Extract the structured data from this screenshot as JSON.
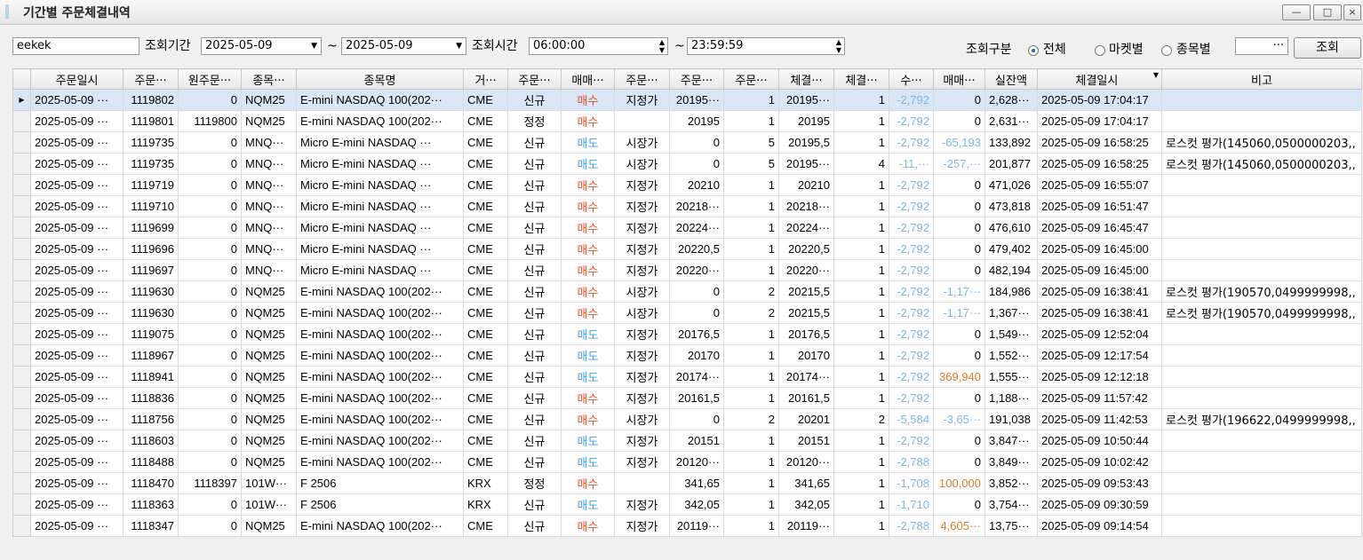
{
  "window": {
    "title": "기간별 주문체결내역",
    "min_label": "—",
    "max_label": "□",
    "close_label": "×"
  },
  "toolbar": {
    "account": "eekek",
    "period_label": "조회기간",
    "date_from": "2025-05-09",
    "tilde": "~",
    "date_to": "2025-05-09",
    "time_label": "조회시간",
    "time_from": "06:00:00",
    "time_to": "23:59:59",
    "category_label": "조회구분",
    "opt_all": "전체",
    "opt_market": "마켓별",
    "opt_symbol": "종목별",
    "symbol_btn": "···",
    "search_btn": "조회"
  },
  "columns": [
    "주문일시",
    "주문···",
    "원주문···",
    "종목···",
    "종목명",
    "거···",
    "주문···",
    "매매···",
    "주문···",
    "주문···",
    "주문···",
    "체결···",
    "체결···",
    "수···",
    "매매···",
    "실잔액",
    "체결일시",
    "비고"
  ],
  "rows": [
    [
      "2025-05-09 ···",
      "1119802",
      "0",
      "NQM25",
      "E-mini NASDAQ 100(202···",
      "CME",
      "신규",
      "매수",
      "지정가",
      "20195···",
      "1",
      "20195···",
      "1",
      "-2,792",
      "0",
      "2,628···",
      "2025-05-09 17:04:17",
      ""
    ],
    [
      "2025-05-09 ···",
      "1119801",
      "1119800",
      "NQM25",
      "E-mini NASDAQ 100(202···",
      "CME",
      "정정",
      "매수",
      "",
      "20195",
      "1",
      "20195",
      "1",
      "-2,792",
      "0",
      "2,631···",
      "2025-05-09 17:04:17",
      ""
    ],
    [
      "2025-05-09 ···",
      "1119735",
      "0",
      "MNQ···",
      "Micro E-mini NASDAQ ···",
      "CME",
      "신규",
      "매도",
      "시장가",
      "0",
      "5",
      "20195,5",
      "1",
      "-2,792",
      "-65,193",
      "133,892",
      "2025-05-09 16:58:25",
      "로스컷 평가(145060,0500000203,,"
    ],
    [
      "2025-05-09 ···",
      "1119735",
      "0",
      "MNQ···",
      "Micro E-mini NASDAQ ···",
      "CME",
      "신규",
      "매도",
      "시장가",
      "0",
      "5",
      "20195···",
      "4",
      "-11,···",
      "-257,···",
      "201,877",
      "2025-05-09 16:58:25",
      "로스컷 평가(145060,0500000203,,"
    ],
    [
      "2025-05-09 ···",
      "1119719",
      "0",
      "MNQ···",
      "Micro E-mini NASDAQ ···",
      "CME",
      "신규",
      "매수",
      "지정가",
      "20210",
      "1",
      "20210",
      "1",
      "-2,792",
      "0",
      "471,026",
      "2025-05-09 16:55:07",
      ""
    ],
    [
      "2025-05-09 ···",
      "1119710",
      "0",
      "MNQ···",
      "Micro E-mini NASDAQ ···",
      "CME",
      "신규",
      "매수",
      "지정가",
      "20218···",
      "1",
      "20218···",
      "1",
      "-2,792",
      "0",
      "473,818",
      "2025-05-09 16:51:47",
      ""
    ],
    [
      "2025-05-09 ···",
      "1119699",
      "0",
      "MNQ···",
      "Micro E-mini NASDAQ ···",
      "CME",
      "신규",
      "매수",
      "지정가",
      "20224···",
      "1",
      "20224···",
      "1",
      "-2,792",
      "0",
      "476,610",
      "2025-05-09 16:45:47",
      ""
    ],
    [
      "2025-05-09 ···",
      "1119696",
      "0",
      "MNQ···",
      "Micro E-mini NASDAQ ···",
      "CME",
      "신규",
      "매수",
      "지정가",
      "20220,5",
      "1",
      "20220,5",
      "1",
      "-2,792",
      "0",
      "479,402",
      "2025-05-09 16:45:00",
      ""
    ],
    [
      "2025-05-09 ···",
      "1119697",
      "0",
      "MNQ···",
      "Micro E-mini NASDAQ ···",
      "CME",
      "신규",
      "매수",
      "지정가",
      "20220···",
      "1",
      "20220···",
      "1",
      "-2,792",
      "0",
      "482,194",
      "2025-05-09 16:45:00",
      ""
    ],
    [
      "2025-05-09 ···",
      "1119630",
      "0",
      "NQM25",
      "E-mini NASDAQ 100(202···",
      "CME",
      "신규",
      "매수",
      "시장가",
      "0",
      "2",
      "20215,5",
      "1",
      "-2,792",
      "-1,17···",
      "184,986",
      "2025-05-09 16:38:41",
      "로스컷 평가(190570,0499999998,,"
    ],
    [
      "2025-05-09 ···",
      "1119630",
      "0",
      "NQM25",
      "E-mini NASDAQ 100(202···",
      "CME",
      "신규",
      "매수",
      "시장가",
      "0",
      "2",
      "20215,5",
      "1",
      "-2,792",
      "-1,17···",
      "1,367···",
      "2025-05-09 16:38:41",
      "로스컷 평가(190570,0499999998,,"
    ],
    [
      "2025-05-09 ···",
      "1119075",
      "0",
      "NQM25",
      "E-mini NASDAQ 100(202···",
      "CME",
      "신규",
      "매도",
      "지정가",
      "20176,5",
      "1",
      "20176,5",
      "1",
      "-2,792",
      "0",
      "1,549···",
      "2025-05-09 12:52:04",
      ""
    ],
    [
      "2025-05-09 ···",
      "1118967",
      "0",
      "NQM25",
      "E-mini NASDAQ 100(202···",
      "CME",
      "신규",
      "매도",
      "지정가",
      "20170",
      "1",
      "20170",
      "1",
      "-2,792",
      "0",
      "1,552···",
      "2025-05-09 12:17:54",
      ""
    ],
    [
      "2025-05-09 ···",
      "1118941",
      "0",
      "NQM25",
      "E-mini NASDAQ 100(202···",
      "CME",
      "신규",
      "매도",
      "지정가",
      "20174···",
      "1",
      "20174···",
      "1",
      "-2,792",
      "369,940",
      "1,555···",
      "2025-05-09 12:12:18",
      ""
    ],
    [
      "2025-05-09 ···",
      "1118836",
      "0",
      "NQM25",
      "E-mini NASDAQ 100(202···",
      "CME",
      "신규",
      "매수",
      "지정가",
      "20161,5",
      "1",
      "20161,5",
      "1",
      "-2,792",
      "0",
      "1,188···",
      "2025-05-09 11:57:42",
      ""
    ],
    [
      "2025-05-09 ···",
      "1118756",
      "0",
      "NQM25",
      "E-mini NASDAQ 100(202···",
      "CME",
      "신규",
      "매수",
      "시장가",
      "0",
      "2",
      "20201",
      "2",
      "-5,584",
      "-3,65···",
      "191,038",
      "2025-05-09 11:42:53",
      "로스컷 평가(196622,0499999998,,"
    ],
    [
      "2025-05-09 ···",
      "1118603",
      "0",
      "NQM25",
      "E-mini NASDAQ 100(202···",
      "CME",
      "신규",
      "매도",
      "지정가",
      "20151",
      "1",
      "20151",
      "1",
      "-2,792",
      "0",
      "3,847···",
      "2025-05-09 10:50:44",
      ""
    ],
    [
      "2025-05-09 ···",
      "1118488",
      "0",
      "NQM25",
      "E-mini NASDAQ 100(202···",
      "CME",
      "신규",
      "매도",
      "지정가",
      "20120···",
      "1",
      "20120···",
      "1",
      "-2,788",
      "0",
      "3,849···",
      "2025-05-09 10:02:42",
      ""
    ],
    [
      "2025-05-09 ···",
      "1118470",
      "1118397",
      "101W···",
      "F 2506",
      "KRX",
      "정정",
      "매수",
      "",
      "341,65",
      "1",
      "341,65",
      "1",
      "-1,708",
      "100,000",
      "3,852···",
      "2025-05-09 09:53:43",
      ""
    ],
    [
      "2025-05-09 ···",
      "1118363",
      "0",
      "101W···",
      "F 2506",
      "KRX",
      "신규",
      "매도",
      "지정가",
      "342,05",
      "1",
      "342,05",
      "1",
      "-1,710",
      "0",
      "3,754···",
      "2025-05-09 09:30:59",
      ""
    ],
    [
      "2025-05-09 ···",
      "1118347",
      "0",
      "NQM25",
      "E-mini NASDAQ 100(202···",
      "CME",
      "신규",
      "매수",
      "지정가",
      "20119···",
      "1",
      "20119···",
      "1",
      "-2,788",
      "4,605···",
      "13,75···",
      "2025-05-09 09:14:54",
      ""
    ]
  ],
  "colors": {
    "buy": "#e8502a",
    "sell": "#3aa0e0",
    "negative": "#7fb6e0",
    "positive": "#e07a2a",
    "selected_row": "#d8e6f6"
  }
}
